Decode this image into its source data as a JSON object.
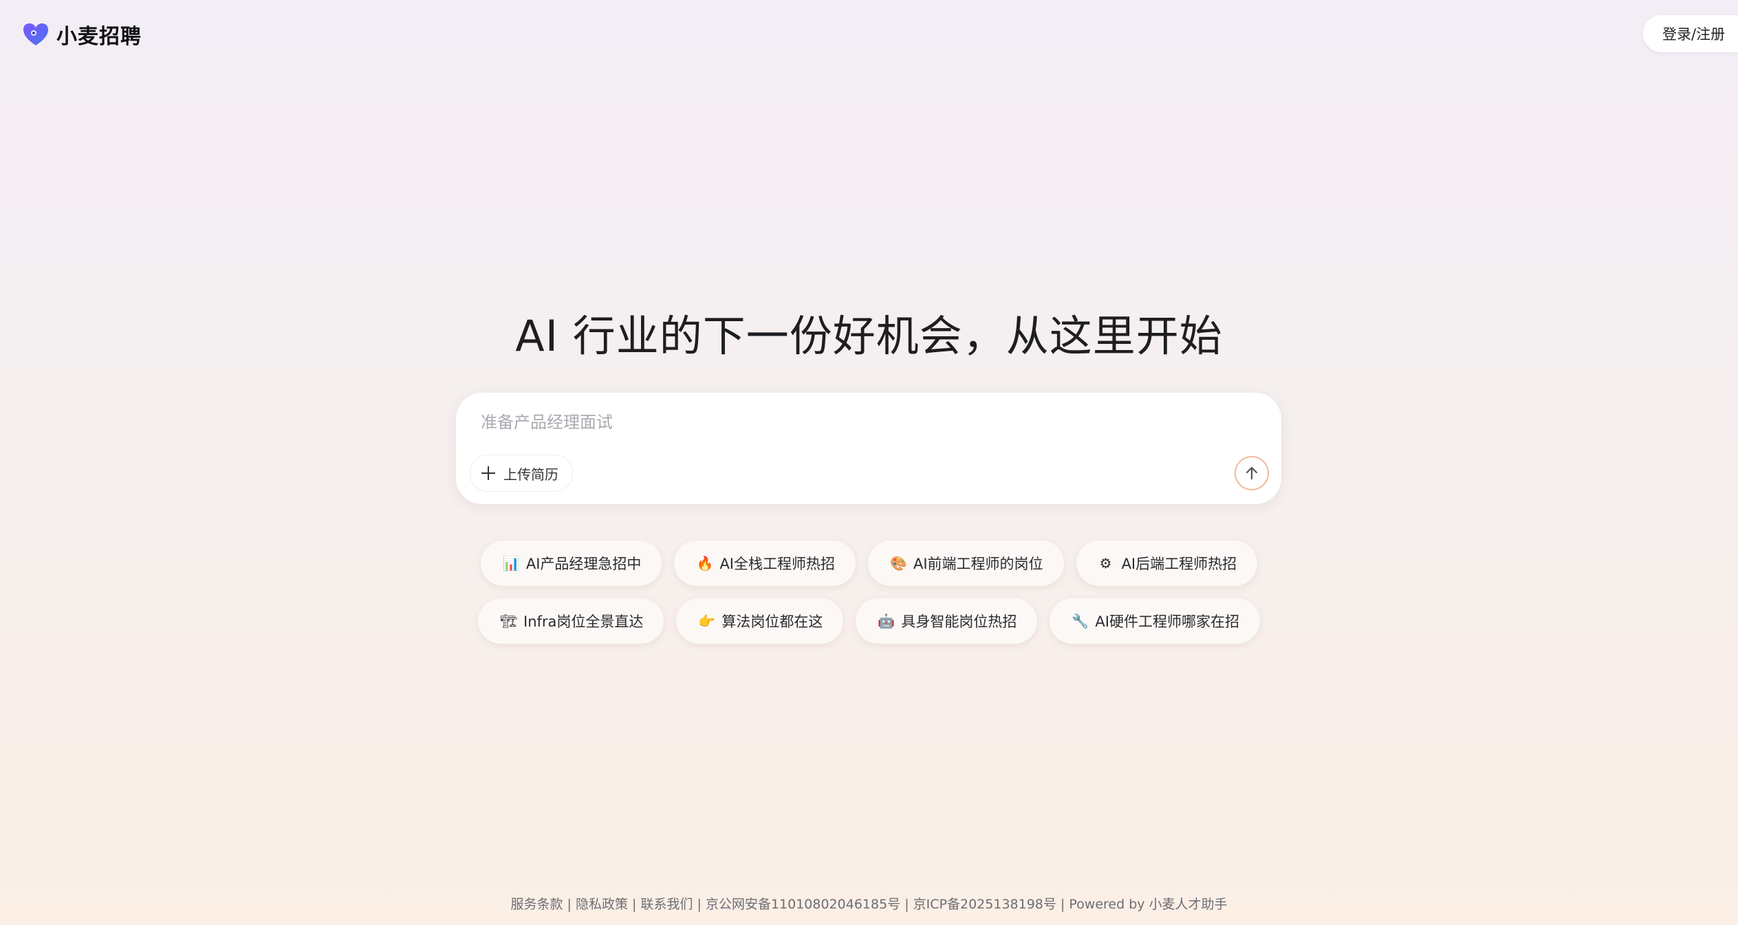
{
  "header": {
    "brand": "小麦招聘",
    "login_label": "登录/注册"
  },
  "hero": {
    "title": "AI 行业的下一份好机会，从这里开始"
  },
  "chat": {
    "placeholder": "准备产品经理面试",
    "upload_label": "上传简历"
  },
  "suggestions": {
    "row1": [
      {
        "icon": "📊",
        "label": "AI产品经理急招中"
      },
      {
        "icon": "🔥",
        "label": "AI全栈工程师热招"
      },
      {
        "icon": "🎨",
        "label": "AI前端工程师的岗位"
      },
      {
        "icon": "⚙",
        "label": "AI后端工程师热招"
      }
    ],
    "row2": [
      {
        "icon": "🏗",
        "label": "Infra岗位全景直达"
      },
      {
        "icon": "👉",
        "label": "算法岗位都在这"
      },
      {
        "icon": "🤖",
        "label": "具身智能岗位热招"
      },
      {
        "icon": "🔧",
        "label": "AI硬件工程师哪家在招"
      }
    ]
  },
  "footer": {
    "terms": "服务条款",
    "privacy": "隐私政策",
    "contact": "联系我们",
    "police_record": "京公网安备11010802046185号",
    "icp_record": "京ICP备2025138198号",
    "powered": "Powered by 小麦人才助手",
    "separator": " | "
  },
  "colors": {
    "brand_primary": "#6b4ef0",
    "brand_secondary": "#4a6ff5",
    "send_border": "#f2b99a"
  },
  "icons": {
    "logo": "heart-logo-icon",
    "plus": "plus-icon",
    "send": "arrow-up-icon"
  }
}
